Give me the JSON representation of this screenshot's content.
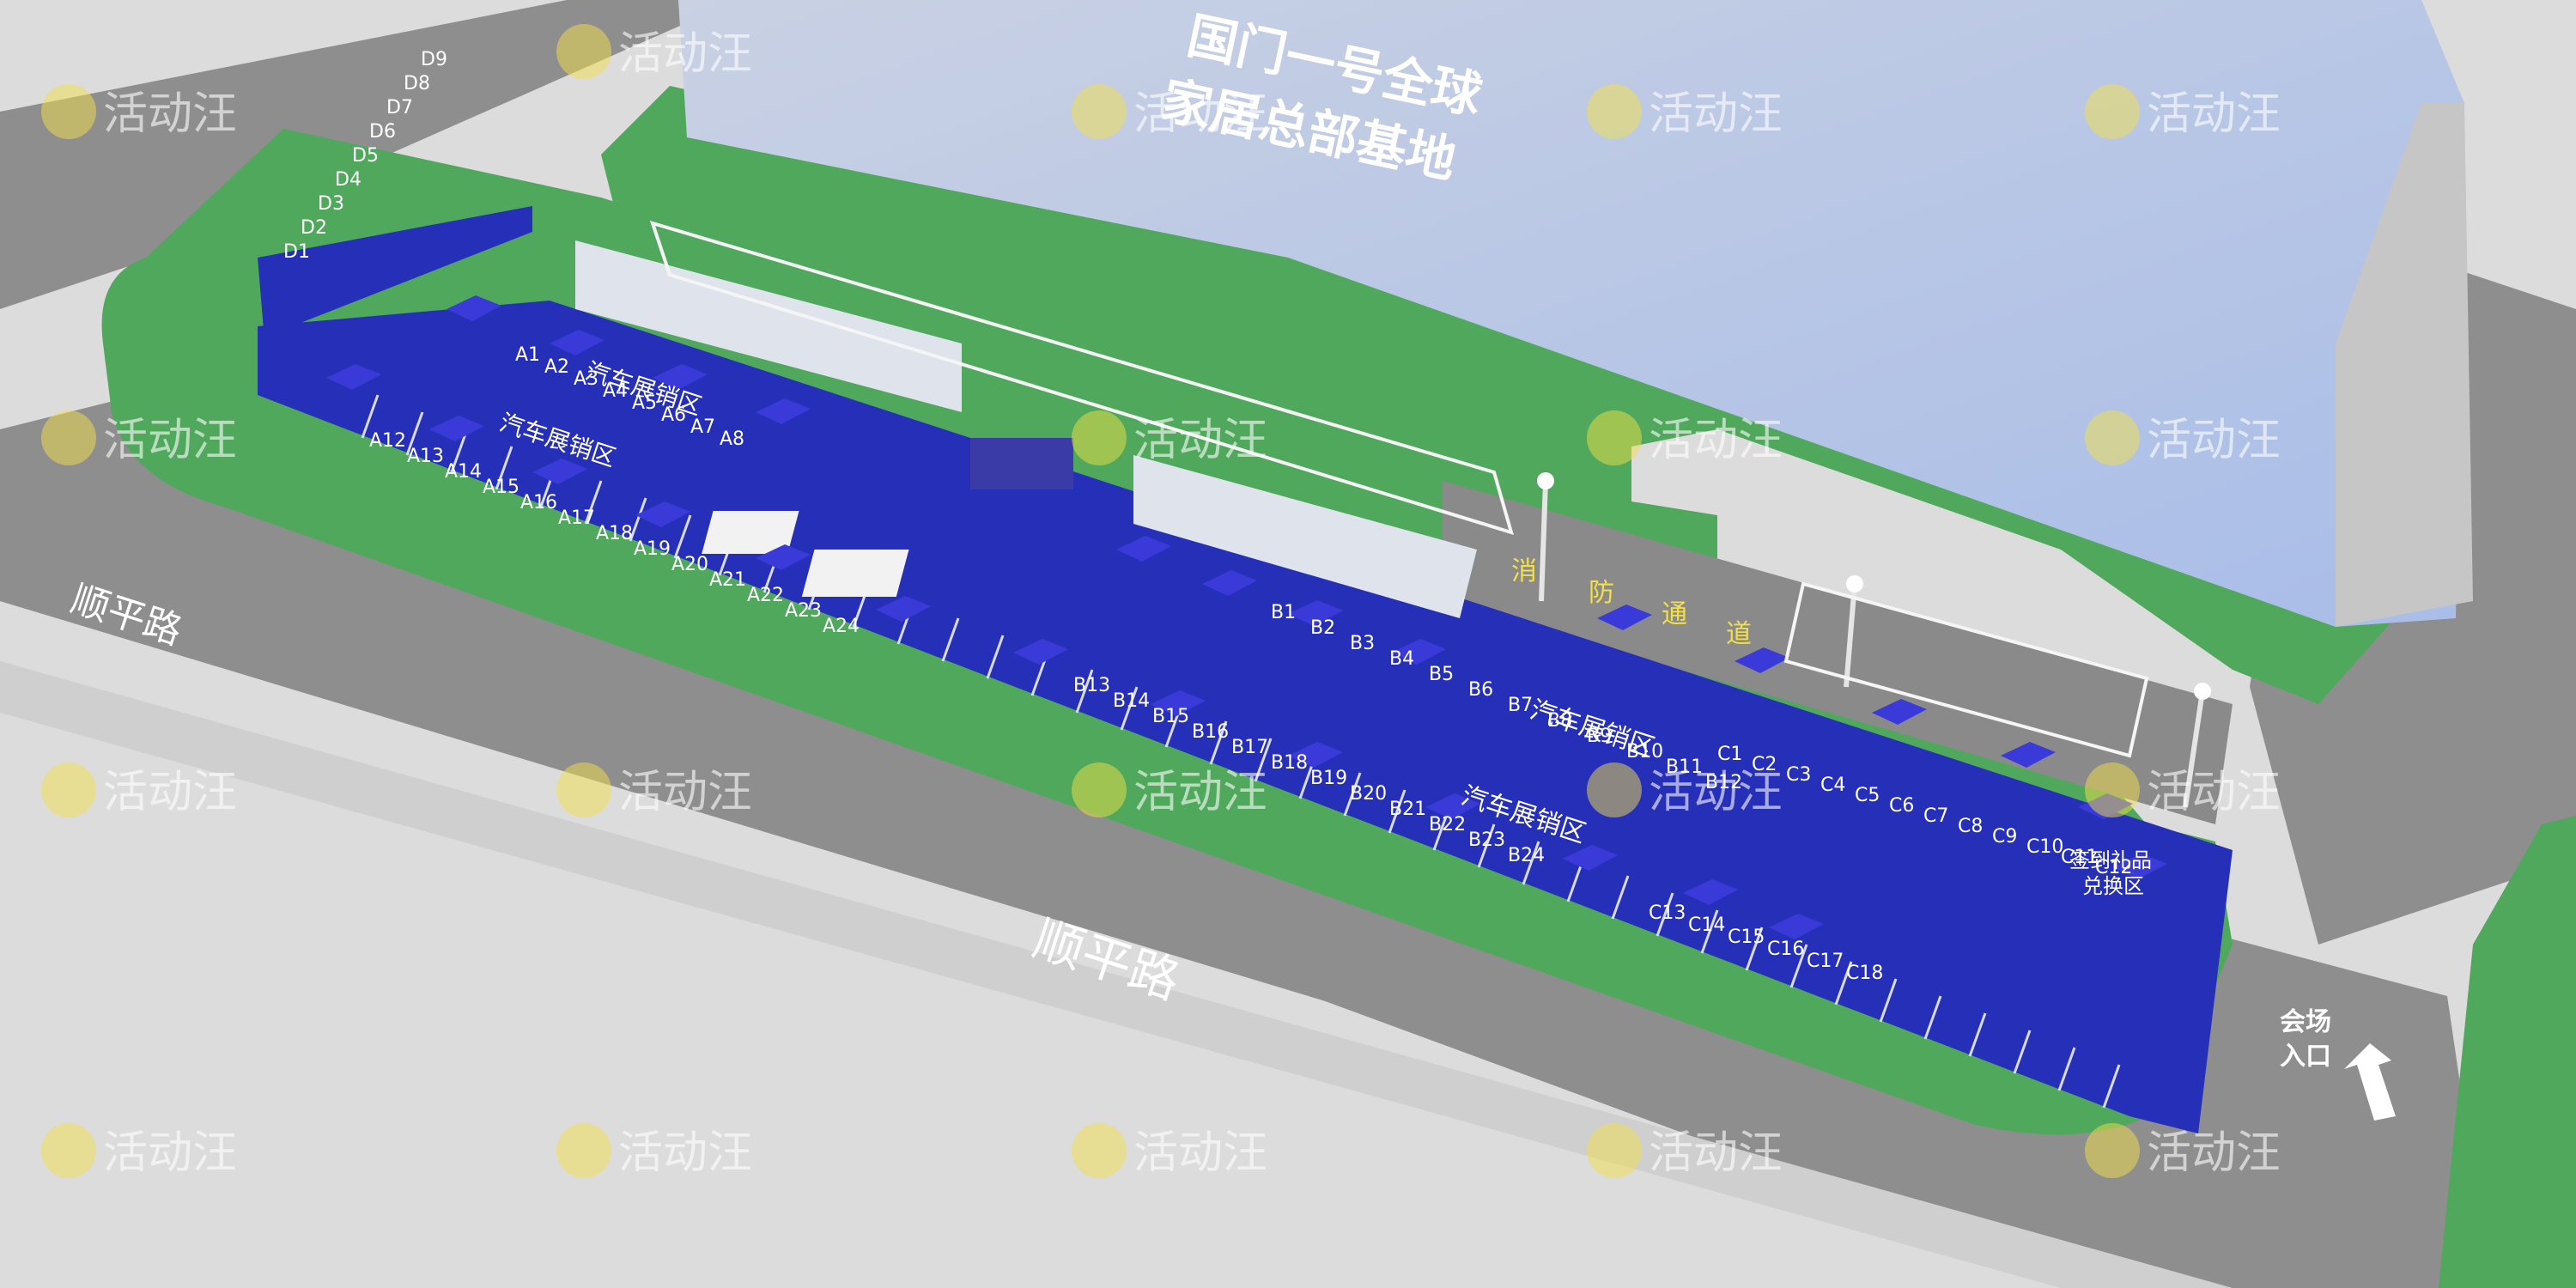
{
  "building": {
    "name_line1": "国门一号全球",
    "name_line2": "家居总部基地"
  },
  "roads": [
    {
      "id": "road-label-left",
      "text": "顺平路"
    },
    {
      "id": "road-label-center",
      "text": "顺平路"
    }
  ],
  "fire_lane": {
    "chars": [
      "消",
      "防",
      "通",
      "道"
    ]
  },
  "zones": [
    {
      "id": "zone-top-1",
      "text": "汽车展销区"
    },
    {
      "id": "zone-top-2",
      "text": "汽车展销区"
    },
    {
      "id": "zone-mid-right",
      "text": "汽车展销区"
    },
    {
      "id": "zone-bottom",
      "text": "汽车展销区"
    }
  ],
  "entrance": {
    "line1": "会场",
    "line2": "入口"
  },
  "gift": {
    "line1": "签到礼品",
    "line2": "兑换区"
  },
  "watermark": {
    "text": "活动汪"
  },
  "parking": {
    "a_row_top": [
      "A1",
      "A2",
      "A3",
      "A4",
      "A5",
      "A6",
      "A7",
      "A8"
    ],
    "a_row_bottom": [
      "A12",
      "A13",
      "A14",
      "A15",
      "A16",
      "A17",
      "A18",
      "A19",
      "A20",
      "A21",
      "A22",
      "A23",
      "A24"
    ],
    "b_row_top": [
      "B1",
      "B2",
      "B3",
      "B4",
      "B5",
      "B6",
      "B7",
      "B8",
      "B9",
      "B10",
      "B11",
      "B12"
    ],
    "b_row_bottom": [
      "B13",
      "B14",
      "B15",
      "B16",
      "B17",
      "B18",
      "B19",
      "B20",
      "B21",
      "B22",
      "B23",
      "B24"
    ],
    "c_row_top": [
      "C1",
      "C2",
      "C3",
      "C4",
      "C5",
      "C6",
      "C7",
      "C8",
      "C9",
      "C10",
      "C11",
      "C12"
    ],
    "c_row_bottom": [
      "C13",
      "C14",
      "C15",
      "C16",
      "C17",
      "C18"
    ],
    "d_row_left": [
      "D1",
      "D2",
      "D3",
      "D4",
      "D5",
      "D6",
      "D7",
      "D8",
      "D9"
    ]
  },
  "colors": {
    "grass": "#4ea85a",
    "carpet": "#2630b8",
    "tent": "#3a3ad8",
    "building": "#b9c6e6",
    "asphalt": "#8f8f8f",
    "ground": "#d9d9d9"
  }
}
